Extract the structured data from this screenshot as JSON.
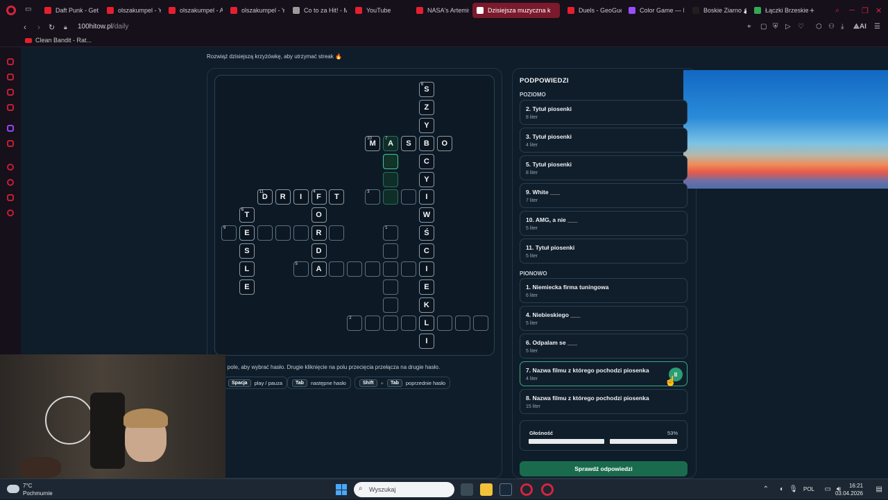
{
  "browser": {
    "tabs": [
      {
        "label": "Daft Punk - Get",
        "color": "#e5202e"
      },
      {
        "label": "olszakumpel - Y",
        "color": "#e5202e"
      },
      {
        "label": "olszakumpel - A",
        "color": "#e5202e"
      },
      {
        "label": "olszakumpel - Y",
        "color": "#e5202e"
      },
      {
        "label": "Co to za Hit! - M",
        "color": "#9a9a9a"
      },
      {
        "label": "YouTube",
        "color": "#e5202e"
      },
      {
        "label": "NASA's Artemis",
        "color": "#e5202e"
      },
      {
        "label": "Dzisiejsza muzyczna k",
        "color": "#ffffff"
      },
      {
        "label": "Duels - GeoGue",
        "color": "#e5202e"
      },
      {
        "label": "Color Game — I",
        "color": "#9a4dff"
      },
      {
        "label": "Boskie Ziarno ☕",
        "color": "#1f1f1f"
      },
      {
        "label": "Łączki Brzeskie",
        "color": "#34a853"
      }
    ],
    "url_host": "100hitow.pl",
    "url_path": "/daily",
    "bookmark": "Clean Bandit - Rat..."
  },
  "page": {
    "subtitle": "Rozwiąż dzisiejszą krzyżówkę, aby utrzymać streak 🔥",
    "instruction": "ij pole, aby wybrać hasło. Drugie kliknięcie na polu przecięcia przełącza na drugie hasło.",
    "shortcuts": [
      {
        "keys": [
          "Spacja"
        ],
        "label": "play / pauza"
      },
      {
        "keys": [
          "Tab"
        ],
        "label": "następne hasło"
      },
      {
        "keys": [
          "Shift",
          "Tab"
        ],
        "label": "poprzednie hasło",
        "joiner": "+"
      }
    ]
  },
  "crossword": {
    "cells": [
      {
        "c": 11,
        "r": 0,
        "ch": "S",
        "n": "8"
      },
      {
        "c": 11,
        "r": 1,
        "ch": "Z"
      },
      {
        "c": 11,
        "r": 2,
        "ch": "Y"
      },
      {
        "c": 8,
        "r": 3,
        "ch": "M",
        "n": "10"
      },
      {
        "c": 9,
        "r": 3,
        "ch": "A",
        "n": "7",
        "st": "hl"
      },
      {
        "c": 10,
        "r": 3,
        "ch": "S"
      },
      {
        "c": 11,
        "r": 3,
        "ch": "B"
      },
      {
        "c": 12,
        "r": 3,
        "ch": "O"
      },
      {
        "c": 9,
        "r": 4,
        "ch": "",
        "st": "sel"
      },
      {
        "c": 11,
        "r": 4,
        "ch": "C"
      },
      {
        "c": 9,
        "r": 5,
        "ch": "",
        "st": "hl"
      },
      {
        "c": 11,
        "r": 5,
        "ch": "Y"
      },
      {
        "c": 2,
        "r": 6,
        "ch": "D",
        "n": "11"
      },
      {
        "c": 3,
        "r": 6,
        "ch": "R"
      },
      {
        "c": 4,
        "r": 6,
        "ch": "I"
      },
      {
        "c": 5,
        "r": 6,
        "ch": "F",
        "n": "4"
      },
      {
        "c": 6,
        "r": 6,
        "ch": "T"
      },
      {
        "c": 8,
        "r": 6,
        "ch": "",
        "n": "3"
      },
      {
        "c": 9,
        "r": 6,
        "ch": "",
        "st": "hl"
      },
      {
        "c": 10,
        "r": 6,
        "ch": ""
      },
      {
        "c": 11,
        "r": 6,
        "ch": "I"
      },
      {
        "c": 1,
        "r": 7,
        "ch": "T",
        "n": "6"
      },
      {
        "c": 5,
        "r": 7,
        "ch": "O"
      },
      {
        "c": 11,
        "r": 7,
        "ch": "W"
      },
      {
        "c": 0,
        "r": 8,
        "ch": "",
        "n": "9"
      },
      {
        "c": 1,
        "r": 8,
        "ch": "E"
      },
      {
        "c": 2,
        "r": 8,
        "ch": ""
      },
      {
        "c": 3,
        "r": 8,
        "ch": ""
      },
      {
        "c": 4,
        "r": 8,
        "ch": ""
      },
      {
        "c": 5,
        "r": 8,
        "ch": "R"
      },
      {
        "c": 6,
        "r": 8,
        "ch": ""
      },
      {
        "c": 9,
        "r": 8,
        "ch": "",
        "n": "1"
      },
      {
        "c": 11,
        "r": 8,
        "ch": "Ś"
      },
      {
        "c": 1,
        "r": 9,
        "ch": "S"
      },
      {
        "c": 5,
        "r": 9,
        "ch": "D"
      },
      {
        "c": 9,
        "r": 9,
        "ch": ""
      },
      {
        "c": 11,
        "r": 9,
        "ch": "C"
      },
      {
        "c": 1,
        "r": 10,
        "ch": "L"
      },
      {
        "c": 4,
        "r": 10,
        "ch": "",
        "n": "5"
      },
      {
        "c": 5,
        "r": 10,
        "ch": "A"
      },
      {
        "c": 6,
        "r": 10,
        "ch": ""
      },
      {
        "c": 7,
        "r": 10,
        "ch": ""
      },
      {
        "c": 8,
        "r": 10,
        "ch": ""
      },
      {
        "c": 9,
        "r": 10,
        "ch": ""
      },
      {
        "c": 10,
        "r": 10,
        "ch": ""
      },
      {
        "c": 11,
        "r": 10,
        "ch": "I"
      },
      {
        "c": 1,
        "r": 11,
        "ch": "E"
      },
      {
        "c": 9,
        "r": 11,
        "ch": ""
      },
      {
        "c": 11,
        "r": 11,
        "ch": "E"
      },
      {
        "c": 9,
        "r": 12,
        "ch": ""
      },
      {
        "c": 11,
        "r": 12,
        "ch": "K"
      },
      {
        "c": 7,
        "r": 13,
        "ch": "",
        "n": "2"
      },
      {
        "c": 8,
        "r": 13,
        "ch": ""
      },
      {
        "c": 9,
        "r": 13,
        "ch": ""
      },
      {
        "c": 10,
        "r": 13,
        "ch": ""
      },
      {
        "c": 11,
        "r": 13,
        "ch": "L"
      },
      {
        "c": 12,
        "r": 13,
        "ch": ""
      },
      {
        "c": 13,
        "r": 13,
        "ch": ""
      },
      {
        "c": 14,
        "r": 13,
        "ch": ""
      },
      {
        "c": 11,
        "r": 14,
        "ch": "I"
      }
    ]
  },
  "hints": {
    "title": "PODPOWIEDZI",
    "across_label": "POZIOMO",
    "down_label": "PIONOWO",
    "across": [
      {
        "title": "2. Tytuł piosenki",
        "len": "8 liter"
      },
      {
        "title": "3. Tytuł piosenki",
        "len": "4 liter"
      },
      {
        "title": "5. Tytuł piosenki",
        "len": "8 liter"
      },
      {
        "title": "9. White ___",
        "len": "7 liter"
      },
      {
        "title": "10. AMG, a nie ___",
        "len": "5 liter"
      },
      {
        "title": "11. Tytuł piosenki",
        "len": "5 liter"
      }
    ],
    "down": [
      {
        "title": "1. Niemiecka firma tuningowa",
        "len": "6 liter"
      },
      {
        "title": "4. Niebieskiego ___",
        "len": "5 liter"
      },
      {
        "title": "6. Odpalam se ___",
        "len": "5 liter"
      },
      {
        "title": "7. Nazwa filmu z którego pochodzi piosenka",
        "len": "4 liter",
        "active": true
      },
      {
        "title": "8. Nazwa filmu z którego pochodzi piosenka",
        "len": "15 liter"
      }
    ],
    "pause_glyph": "II",
    "volume_label": "Głośność",
    "volume_pct": "53%",
    "volume_level": 0.53,
    "check_button": "Sprawdź odpowiedzi"
  },
  "taskbar": {
    "temp": "7°C",
    "weather": "Pochmurnie",
    "search_placeholder": "Wyszukaj",
    "lang": "POL",
    "time": "16:21",
    "date": "03.04.2026"
  },
  "colors": {
    "accent_green": "#2b9d74",
    "opera_red": "#d6243c",
    "page_bg": "#0f1c29"
  }
}
